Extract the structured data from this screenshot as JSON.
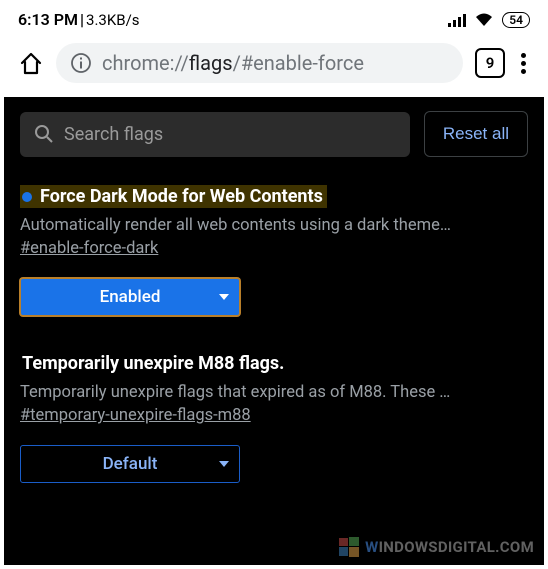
{
  "statusbar": {
    "time": "6:13 PM",
    "sep": " | ",
    "net": "3.3KB/s",
    "battery": "54"
  },
  "browser": {
    "url_prefix": "chrome://",
    "url_bold": "flags",
    "url_suffix": "/#enable-force",
    "tab_count": "9"
  },
  "toolbar": {
    "search_placeholder": "Search flags",
    "reset_label": "Reset all"
  },
  "flags": [
    {
      "highlighted": true,
      "title": "Force Dark Mode for Web Contents",
      "desc": "Automatically render all web contents using a dark theme…",
      "anchor": "#enable-force-dark",
      "value": "Enabled",
      "style": "enabled"
    },
    {
      "highlighted": false,
      "title": "Temporarily unexpire M88 flags.",
      "desc": "Temporarily unexpire flags that expired as of M88. These …",
      "anchor": "#temporary-unexpire-flags-m88",
      "value": "Default",
      "style": "default"
    }
  ],
  "watermark": {
    "w": "W",
    "text": "INDOWSDIGITAL.COM"
  }
}
